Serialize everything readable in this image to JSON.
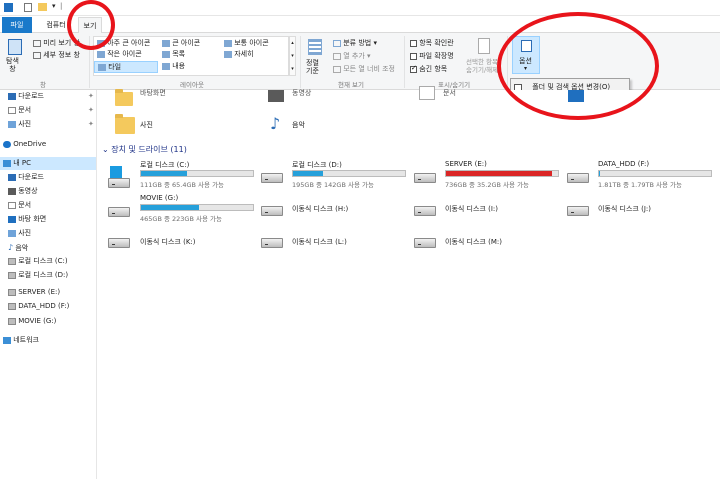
{
  "ribbon_tabs": {
    "file": "파일",
    "computer": "컴퓨터",
    "view": "보기"
  },
  "pane_group": {
    "nav_pane_label": "탐색\n창",
    "preview_pane": "미리 보기 창",
    "details_pane": "세부 정보 창",
    "group_label": "창"
  },
  "layout_group": {
    "extra_large": "아주 큰 아이콘",
    "large": "큰 아이콘",
    "medium": "보통 아이콘",
    "small": "작은 아이콘",
    "list": "목록",
    "details": "자세히",
    "tiles": "타일",
    "content": "내용",
    "group_label": "레이아웃"
  },
  "current_view_group": {
    "sort_label": "정렬\n기준",
    "group_by": "분류 방법",
    "add_column": "열 추가",
    "fit_columns": "모든 열 너비 조정",
    "group_label": "현재 보기"
  },
  "show_hide_group": {
    "item_checkboxes": "항목 확인란",
    "file_extensions": "파일 확장명",
    "hidden_items": "숨긴 항목",
    "hide_selected": "선택한 항목\n숨기기/해제",
    "group_label": "표시/숨기기",
    "item_checkboxes_checked": false,
    "file_extensions_checked": false,
    "hidden_items_checked": true
  },
  "options": {
    "label": "옵션",
    "menu_item": "폴더 및 검색 옵션 변경(O)"
  },
  "nav": {
    "items": [
      {
        "label": "다운로드"
      },
      {
        "label": "문서"
      },
      {
        "label": "사진"
      },
      {
        "label": "OneDrive"
      },
      {
        "label": "내 PC"
      },
      {
        "label": "다운로드"
      },
      {
        "label": "동영상"
      },
      {
        "label": "문서"
      },
      {
        "label": "바탕 화면"
      },
      {
        "label": "사진"
      },
      {
        "label": "음악"
      },
      {
        "label": "로컬 디스크 (C:)"
      },
      {
        "label": "로컬 디스크 (D:)"
      },
      {
        "label": "SERVER (E:)"
      },
      {
        "label": "DATA_HDD (F:)"
      },
      {
        "label": "MOVIE (G:)"
      },
      {
        "label": "네트워크"
      }
    ]
  },
  "folders": {
    "partial1": "바탕화면",
    "partial2": "동영상",
    "partial3": "문서",
    "pictures": "사진",
    "music": "음악"
  },
  "section_header": "장치 및 드라이브 (11)",
  "drives": [
    {
      "name": "로컬 디스크 (C:)",
      "size_text": "111GB 중 65.4GB 사용 가능",
      "used_fraction": 0.41,
      "color": "#26a0da"
    },
    {
      "name": "로컬 디스크 (D:)",
      "size_text": "195GB 중 142GB 사용 가능",
      "used_fraction": 0.27,
      "color": "#26a0da"
    },
    {
      "name": "SERVER (E:)",
      "size_text": "736GB 중 35.2GB 사용 가능",
      "used_fraction": 0.95,
      "color": "#da2626"
    },
    {
      "name": "DATA_HDD (F:)",
      "size_text": "1.81TB 중 1.79TB 사용 가능",
      "used_fraction": 0.01,
      "color": "#26a0da"
    },
    {
      "name": "MOVIE (G:)",
      "size_text": "465GB 중 223GB 사용 가능",
      "used_fraction": 0.52,
      "color": "#26a0da"
    },
    {
      "name": "이동식 디스크 (H:)"
    },
    {
      "name": "이동식 디스크 (I:)"
    },
    {
      "name": "이동식 디스크 (J:)"
    },
    {
      "name": "이동식 디스크 (K:)"
    },
    {
      "name": "이동식 디스크 (L:)"
    },
    {
      "name": "이동식 디스크 (M:)"
    }
  ],
  "highlight_color": "#e8141b"
}
